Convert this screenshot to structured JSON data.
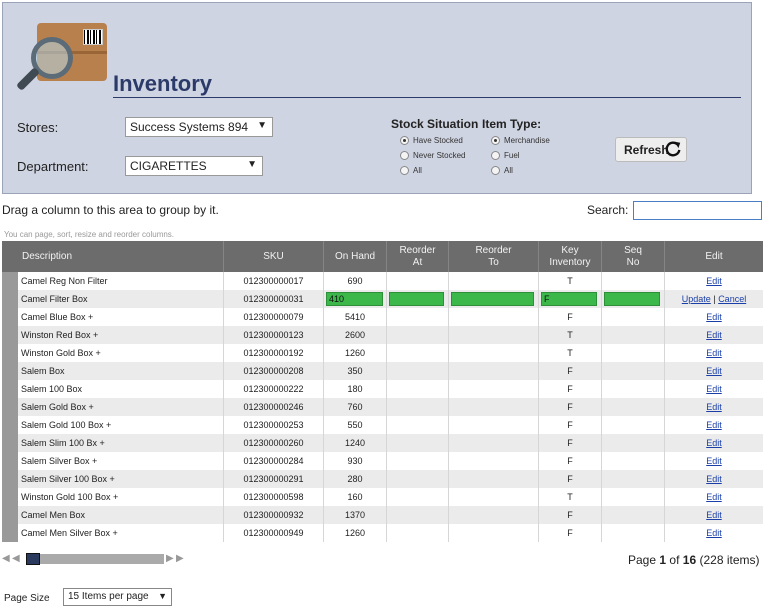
{
  "header": {
    "title": "Inventory"
  },
  "filters": {
    "stores_label": "Stores:",
    "stores_value": "Success Systems 894",
    "department_label": "Department:",
    "department_value": "CIGARETTES",
    "stock_title": "Stock Situation",
    "stock_options": [
      "Have Stocked",
      "Never Stocked",
      "All"
    ],
    "stock_selected": "Have Stocked",
    "itemtype_title": "Item Type:",
    "itemtype_options": [
      "Merchandise",
      "Fuel",
      "All"
    ],
    "itemtype_selected": "Merchandise",
    "refresh_label": "Refresh"
  },
  "toolbar": {
    "group_hint": "Drag a column to this area to group by it.",
    "search_label": "Search:",
    "sub_hint": "You can page, sort, resize and reorder columns."
  },
  "grid": {
    "columns": [
      {
        "label": "Description"
      },
      {
        "label": "SKU"
      },
      {
        "label": "On Hand"
      },
      {
        "label": "Reorder At"
      },
      {
        "label": "Reorder To"
      },
      {
        "label": "Key Inventory"
      },
      {
        "label": "Seq No"
      },
      {
        "label": "Edit"
      }
    ],
    "edit_link": "Edit",
    "update_link": "Update",
    "cancel_link": "Cancel",
    "link_separator": "|",
    "rows": [
      {
        "desc": "Camel Reg Non Filter",
        "sku": "012300000017",
        "onhand": "690",
        "key": "T"
      },
      {
        "desc": "Camel Filter Box",
        "sku": "012300000031",
        "onhand": "410",
        "key": "F",
        "editing": true
      },
      {
        "desc": "Camel Blue Box +",
        "sku": "012300000079",
        "onhand": "5410",
        "key": "F"
      },
      {
        "desc": "Winston Red Box +",
        "sku": "012300000123",
        "onhand": "2600",
        "key": "T"
      },
      {
        "desc": "Winston Gold Box +",
        "sku": "012300000192",
        "onhand": "1260",
        "key": "T"
      },
      {
        "desc": "Salem Box",
        "sku": "012300000208",
        "onhand": "350",
        "key": "F"
      },
      {
        "desc": "Salem 100 Box",
        "sku": "012300000222",
        "onhand": "180",
        "key": "F"
      },
      {
        "desc": "Salem Gold Box +",
        "sku": "012300000246",
        "onhand": "760",
        "key": "F"
      },
      {
        "desc": "Salem Gold 100 Box +",
        "sku": "012300000253",
        "onhand": "550",
        "key": "F"
      },
      {
        "desc": "Salem Slim 100 Bx +",
        "sku": "012300000260",
        "onhand": "1240",
        "key": "F"
      },
      {
        "desc": "Salem Silver Box +",
        "sku": "012300000284",
        "onhand": "930",
        "key": "F"
      },
      {
        "desc": "Salem Silver 100 Box +",
        "sku": "012300000291",
        "onhand": "280",
        "key": "F"
      },
      {
        "desc": "Winston Gold 100 Box +",
        "sku": "012300000598",
        "onhand": "160",
        "key": "T"
      },
      {
        "desc": "Camel Men Box",
        "sku": "012300000932",
        "onhand": "1370",
        "key": "F"
      },
      {
        "desc": "Camel Men Silver Box +",
        "sku": "012300000949",
        "onhand": "1260",
        "key": "F"
      }
    ]
  },
  "pager": {
    "page_prefix": "Page",
    "current_page": "1",
    "of_word": "of",
    "total_pages": "16",
    "items_text": "(228 items)",
    "page_size_label": "Page Size",
    "page_size_value": "15 Items per page"
  },
  "colors": {
    "panel_bg": "#cfd4e2",
    "title": "#2c3a6a",
    "grid_header": "#6c6c6c",
    "edit_green": "#3cb84a",
    "link": "#1a3fa8"
  }
}
